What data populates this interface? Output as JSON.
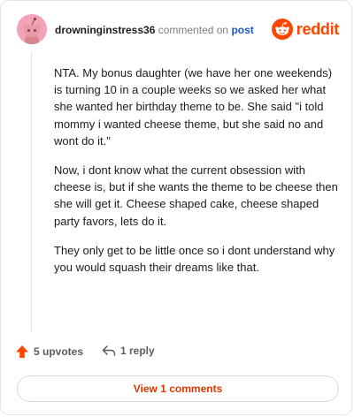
{
  "comment": {
    "username": "drowninginstress36",
    "action_text": "commented on",
    "post_link": "post",
    "avatar_icon": "snoo-avatar-icon",
    "paragraphs": [
      "NTA. My bonus daughter (we have her one weekends) is turning 10 in a couple weeks so we asked her what she wanted her birthday theme to be. She said \"i told mommy i wanted cheese theme, but she said no and wont do it.\"",
      "Now, i dont know what the current obsession with cheese is, but if she wants the theme to be cheese then she will get it. Cheese shaped cake, cheese shaped party favors, lets do it.",
      "They only get to be little once so i dont understand why you would squash their dreams like that."
    ]
  },
  "brand": {
    "name": "reddit",
    "color": "#ff4500",
    "icon": "reddit-logo-icon"
  },
  "actions": {
    "upvotes_label": "5 upvotes",
    "replies_label": "1 reply",
    "upvote_icon": "upvote-arrow-icon",
    "reply_icon": "reply-arrow-icon"
  },
  "footer": {
    "view_comments_label": "View 1 comments"
  }
}
